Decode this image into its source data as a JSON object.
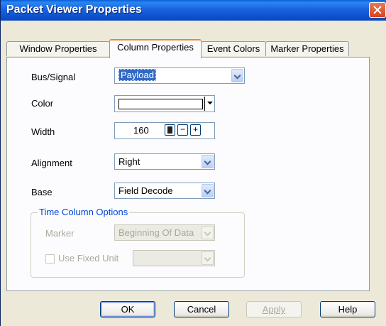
{
  "window": {
    "title": "Packet Viewer Properties"
  },
  "tabs": [
    {
      "label": "Window Properties"
    },
    {
      "label": "Column Properties"
    },
    {
      "label": "Event Colors"
    },
    {
      "label": "Marker Properties"
    }
  ],
  "fields": {
    "bus_signal": {
      "label": "Bus/Signal",
      "value": "Payload"
    },
    "color": {
      "label": "Color",
      "value": "#ffffff"
    },
    "width": {
      "label": "Width",
      "value": "160"
    },
    "alignment": {
      "label": "Alignment",
      "value": "Right"
    },
    "base": {
      "label": "Base",
      "value": "Field Decode"
    }
  },
  "time_options": {
    "title": "Time Column Options",
    "marker_label": "Marker",
    "marker_value": "Beginning Of Data",
    "fixed_unit_label": "Use Fixed Unit",
    "fixed_unit_value": ""
  },
  "buttons": {
    "ok": "OK",
    "cancel": "Cancel",
    "apply": "Apply",
    "help": "Help"
  },
  "colors": {
    "title_bar": "#0a52d0",
    "dialog_bg": "#ece9d8",
    "selection": "#316ac5",
    "group_title": "#0046d5"
  }
}
